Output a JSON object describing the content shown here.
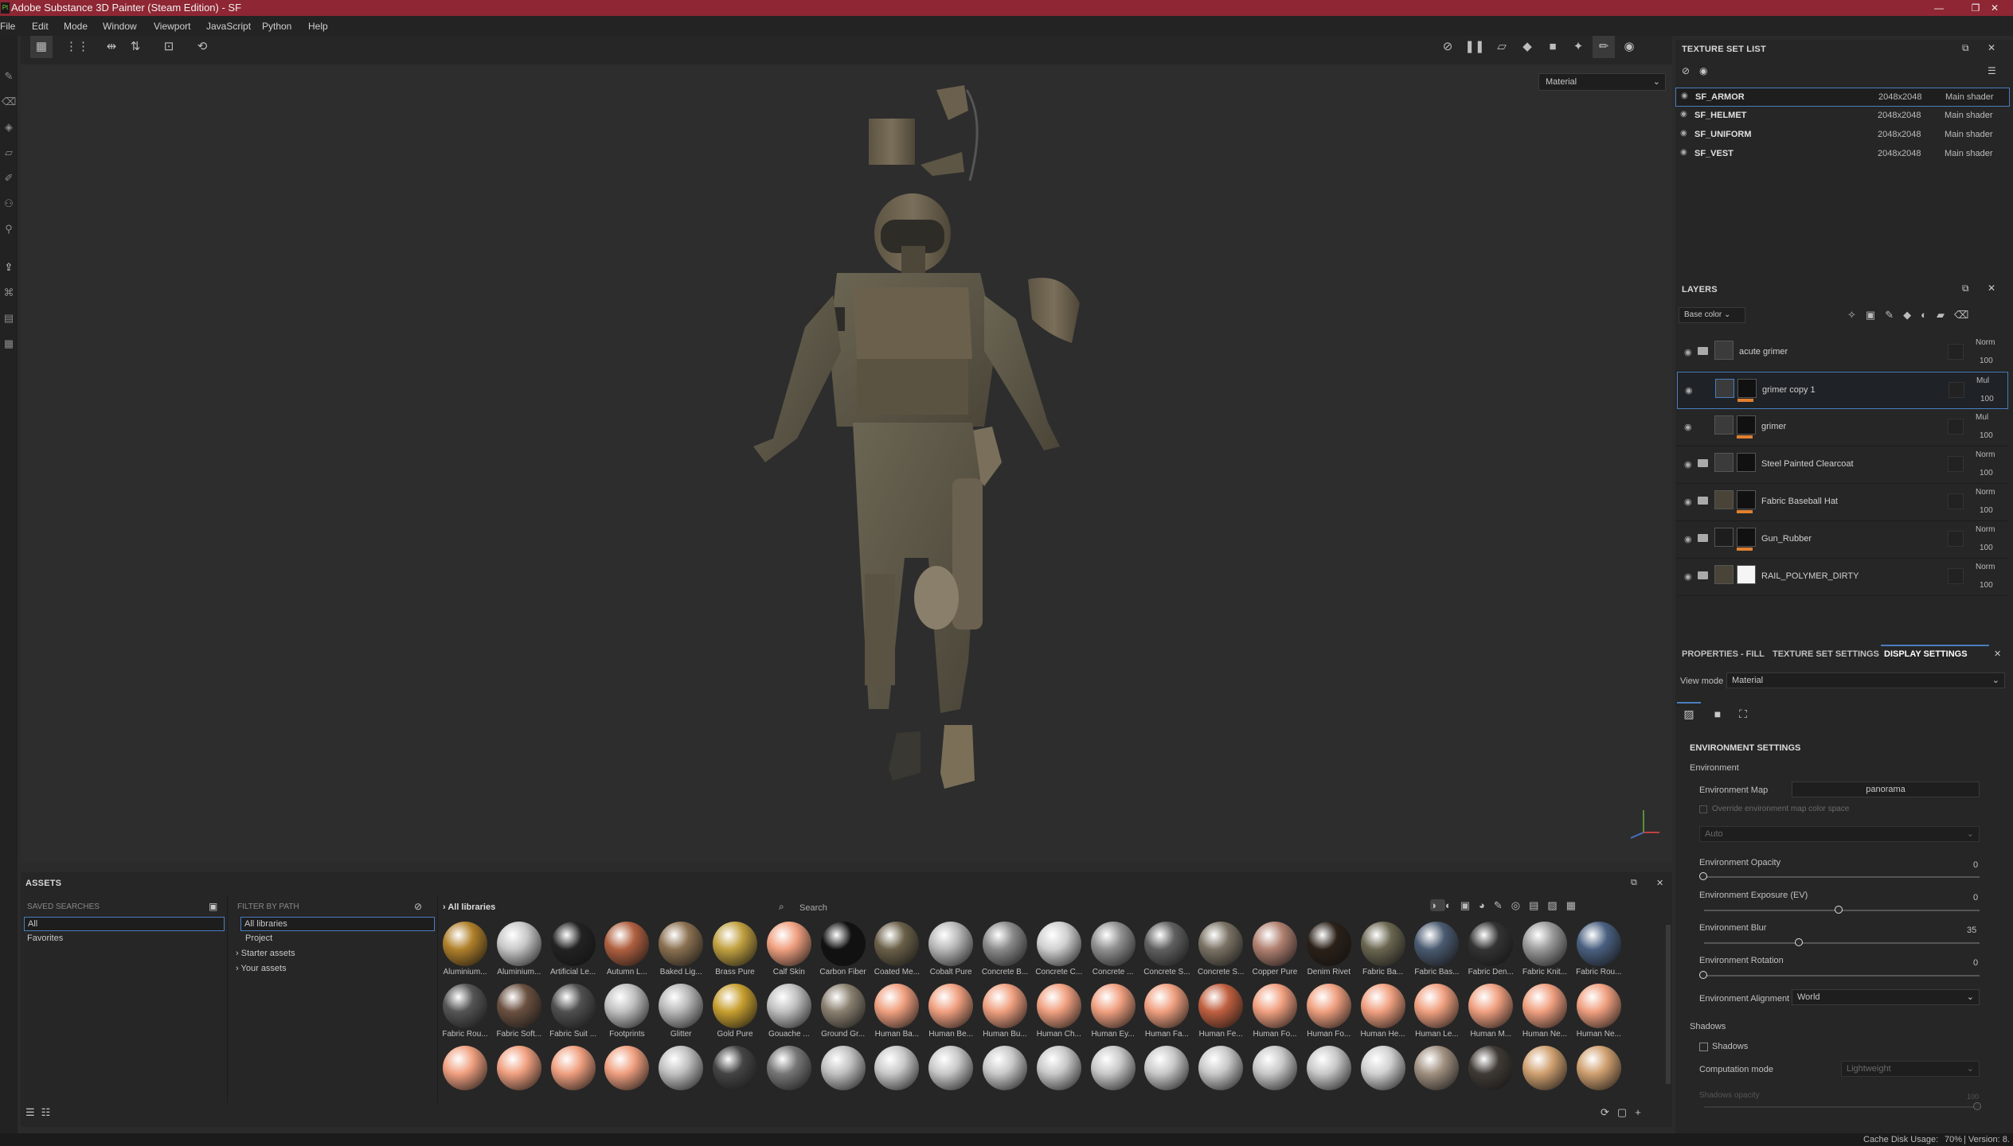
{
  "titlebar": {
    "title": "Adobe Substance 3D Painter (Steam Edition) - SF",
    "app_icon": "Pt"
  },
  "menu": [
    "File",
    "Edit",
    "Mode",
    "Window",
    "Viewport",
    "JavaScript",
    "Python",
    "Help"
  ],
  "viewport": {
    "mode": "Material",
    "axis_gizmo": "axis-gizmo-icon"
  },
  "texture_set_list": {
    "title": "TEXTURE SET LIST",
    "rows": [
      {
        "name": "SF_ARMOR",
        "res": "2048x2048",
        "shader": "Main shader"
      },
      {
        "name": "SF_HELMET",
        "res": "2048x2048",
        "shader": "Main shader"
      },
      {
        "name": "SF_UNIFORM",
        "res": "2048x2048",
        "shader": "Main shader"
      },
      {
        "name": "SF_VEST",
        "res": "2048x2048",
        "shader": "Main shader"
      }
    ]
  },
  "layers": {
    "title": "LAYERS",
    "channel": "Base color",
    "items": [
      {
        "name": "acute grimer",
        "blend": "Norm",
        "opacity": "100"
      },
      {
        "name": "grimer copy 1",
        "blend": "Mul",
        "opacity": "100"
      },
      {
        "name": "grimer",
        "blend": "Mul",
        "opacity": "100"
      },
      {
        "name": "Steel Painted Clearcoat",
        "blend": "Norm",
        "opacity": "100"
      },
      {
        "name": "Fabric Baseball Hat",
        "blend": "Norm",
        "opacity": "100"
      },
      {
        "name": "Gun_Rubber",
        "blend": "Norm",
        "opacity": "100"
      },
      {
        "name": "RAIL_POLYMER_DIRTY",
        "blend": "Norm",
        "opacity": "100"
      }
    ]
  },
  "props": {
    "tabs": [
      "PROPERTIES - FILL",
      "TEXTURE SET SETTINGS",
      "DISPLAY SETTINGS"
    ],
    "view_mode_label": "View mode",
    "view_mode": "Material",
    "env_title": "ENVIRONMENT SETTINGS",
    "environment": "Environment",
    "env_map_label": "Environment Map",
    "env_map": "panorama",
    "override_label": "Override environment map color space",
    "auto": "Auto",
    "opacity_label": "Environment Opacity",
    "opacity_val": "0",
    "exposure_label": "Environment Exposure (EV)",
    "exposure_val": "0",
    "blur_label": "Environment Blur",
    "blur_val": "35",
    "rotation_label": "Environment Rotation",
    "rotation_val": "0",
    "alignment_label": "Environment Alignment",
    "alignment": "World",
    "shadows_title": "Shadows",
    "shadows_check": "Shadows",
    "comp_label": "Computation mode",
    "comp_val": "Lightweight",
    "shadow_opacity_label": "Shadows opacity",
    "shadow_opacity_val": "100"
  },
  "assets": {
    "title": "ASSETS",
    "saved_searches": "SAVED SEARCHES",
    "filter_by_path": "FILTER BY PATH",
    "saved": [
      "All",
      "Favorites"
    ],
    "paths": [
      "All libraries",
      "Project",
      "Starter assets",
      "Your assets"
    ],
    "breadcrumb": "All libraries",
    "search_placeholder": "Search",
    "row1": [
      "Aluminium...",
      "Aluminium...",
      "Artificial Le...",
      "Autumn L...",
      "Baked Lig...",
      "Brass Pure",
      "Calf Skin",
      "Carbon Fiber",
      "Coated Me...",
      "Cobalt Pure",
      "Concrete B...",
      "Concrete C...",
      "Concrete ...",
      "Concrete S...",
      "Concrete S...",
      "Copper Pure",
      "Denim Rivet",
      "Fabric Ba...",
      "Fabric Bas...",
      "Fabric Den...",
      "Fabric Knit...",
      "Fabric Rou..."
    ],
    "row2": [
      "Fabric Rou...",
      "Fabric Soft...",
      "Fabric Suit ...",
      "Footprints",
      "Glitter",
      "Gold Pure",
      "Gouache ...",
      "Ground Gr...",
      "Human Ba...",
      "Human Be...",
      "Human Bu...",
      "Human Ch...",
      "Human Ey...",
      "Human Fa...",
      "Human Fe...",
      "Human Fo...",
      "Human Fo...",
      "Human He...",
      "Human Le...",
      "Human M...",
      "Human Ne...",
      "Human Ne..."
    ]
  },
  "status": {
    "cache": "Cache Disk Usage:",
    "pct": "70%",
    "version": "| Version: 8."
  },
  "colors": {
    "titlebar": "#8e2633",
    "accent_orange": "#e08030",
    "selection": "#4a7dbf"
  }
}
